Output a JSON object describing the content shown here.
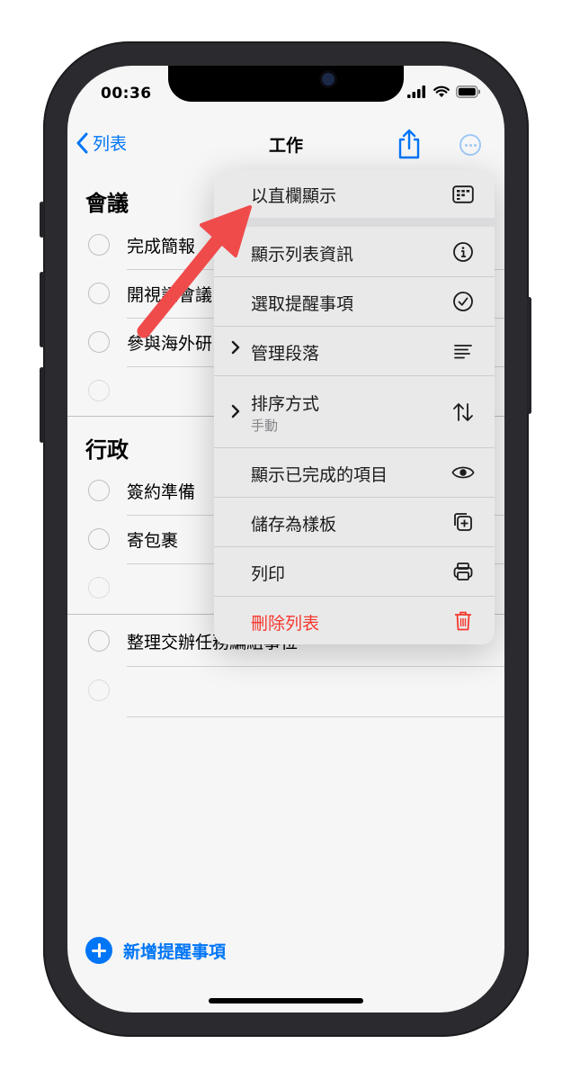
{
  "status": {
    "time": "00:36"
  },
  "nav": {
    "back_label": "列表",
    "title": "工作"
  },
  "sections": [
    {
      "title": "會議",
      "items": [
        "完成簡報",
        "開視訊會議",
        "參與海外研"
      ]
    },
    {
      "title": "行政",
      "items": [
        "簽約準備",
        "寄包裹"
      ]
    }
  ],
  "ungrouped_items": [
    "整理交辦任務編組事位"
  ],
  "add_label": "新增提醒事項",
  "menu": {
    "items": [
      {
        "label": "以直欄顯示",
        "icon": "columns-icon"
      },
      {
        "label": "顯示列表資訊",
        "icon": "info-icon"
      },
      {
        "label": "選取提醒事項",
        "icon": "checkmark-circle-icon"
      },
      {
        "label": "管理段落",
        "icon": "list-lines-icon",
        "has_submenu": true
      },
      {
        "label": "排序方式",
        "sub": "手動",
        "icon": "sort-arrows-icon",
        "has_submenu": true
      },
      {
        "label": "顯示已完成的項目",
        "icon": "eye-icon"
      },
      {
        "label": "儲存為樣板",
        "icon": "add-square-icon"
      },
      {
        "label": "列印",
        "icon": "printer-icon"
      },
      {
        "label": "刪除列表",
        "icon": "trash-icon",
        "destructive": true
      }
    ]
  },
  "colors": {
    "accent": "#007aff",
    "destructive": "#ff3b30",
    "annotation_arrow": "#f04b4b"
  }
}
